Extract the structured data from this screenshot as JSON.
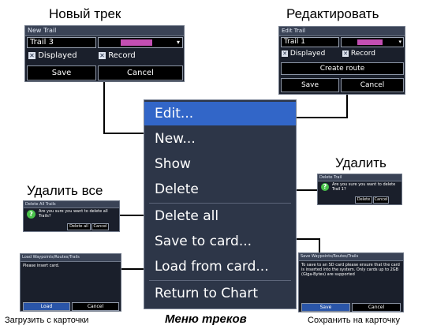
{
  "captions": {
    "new_trail": "Новый трек",
    "edit": "Редактировать",
    "delete": "Удалить",
    "delete_all": "Удалить все",
    "load": "Загрузить с карточки",
    "menu": "Меню треков",
    "save": "Сохранить на карточку"
  },
  "new_trail_dialog": {
    "title": "New Trail",
    "name_value": "Trail 3",
    "color": "#c44fb3",
    "displayed_label": "Displayed",
    "record_label": "Record",
    "save_label": "Save",
    "cancel_label": "Cancel"
  },
  "edit_trail_dialog": {
    "title": "Edit Trail",
    "name_value": "Trail 1",
    "color": "#c44fb3",
    "displayed_label": "Displayed",
    "record_label": "Record",
    "create_route_label": "Create route",
    "save_label": "Save",
    "cancel_label": "Cancel"
  },
  "delete_trail_dialog": {
    "title": "Delete Trail",
    "message": "Are you sure you want to delete Trail 1?",
    "delete_label": "Delete",
    "cancel_label": "Cancel"
  },
  "delete_all_dialog": {
    "title": "Delete All Trails",
    "message": "Are you sure you want to delete all Trails?",
    "delete_all_label": "Delete all",
    "cancel_label": "Cancel"
  },
  "load_dialog": {
    "title": "Load Waypoints/Routes/Trails",
    "message": "Please insert card.",
    "load_label": "Load",
    "cancel_label": "Cancel"
  },
  "save_dialog": {
    "title": "Save Waypoints/Routes/Trails",
    "message": "To save to an SD card please ensure that the card is inserted into the system. Only cards up to 2GB (Giga-Bytes) are supported",
    "save_label": "Save",
    "cancel_label": "Cancel"
  },
  "trails_menu": {
    "items": [
      "Edit...",
      "New...",
      "Show",
      "Delete",
      "Delete all",
      "Save to card...",
      "Load from card...",
      "Return to Chart"
    ],
    "selected_index": 0
  }
}
